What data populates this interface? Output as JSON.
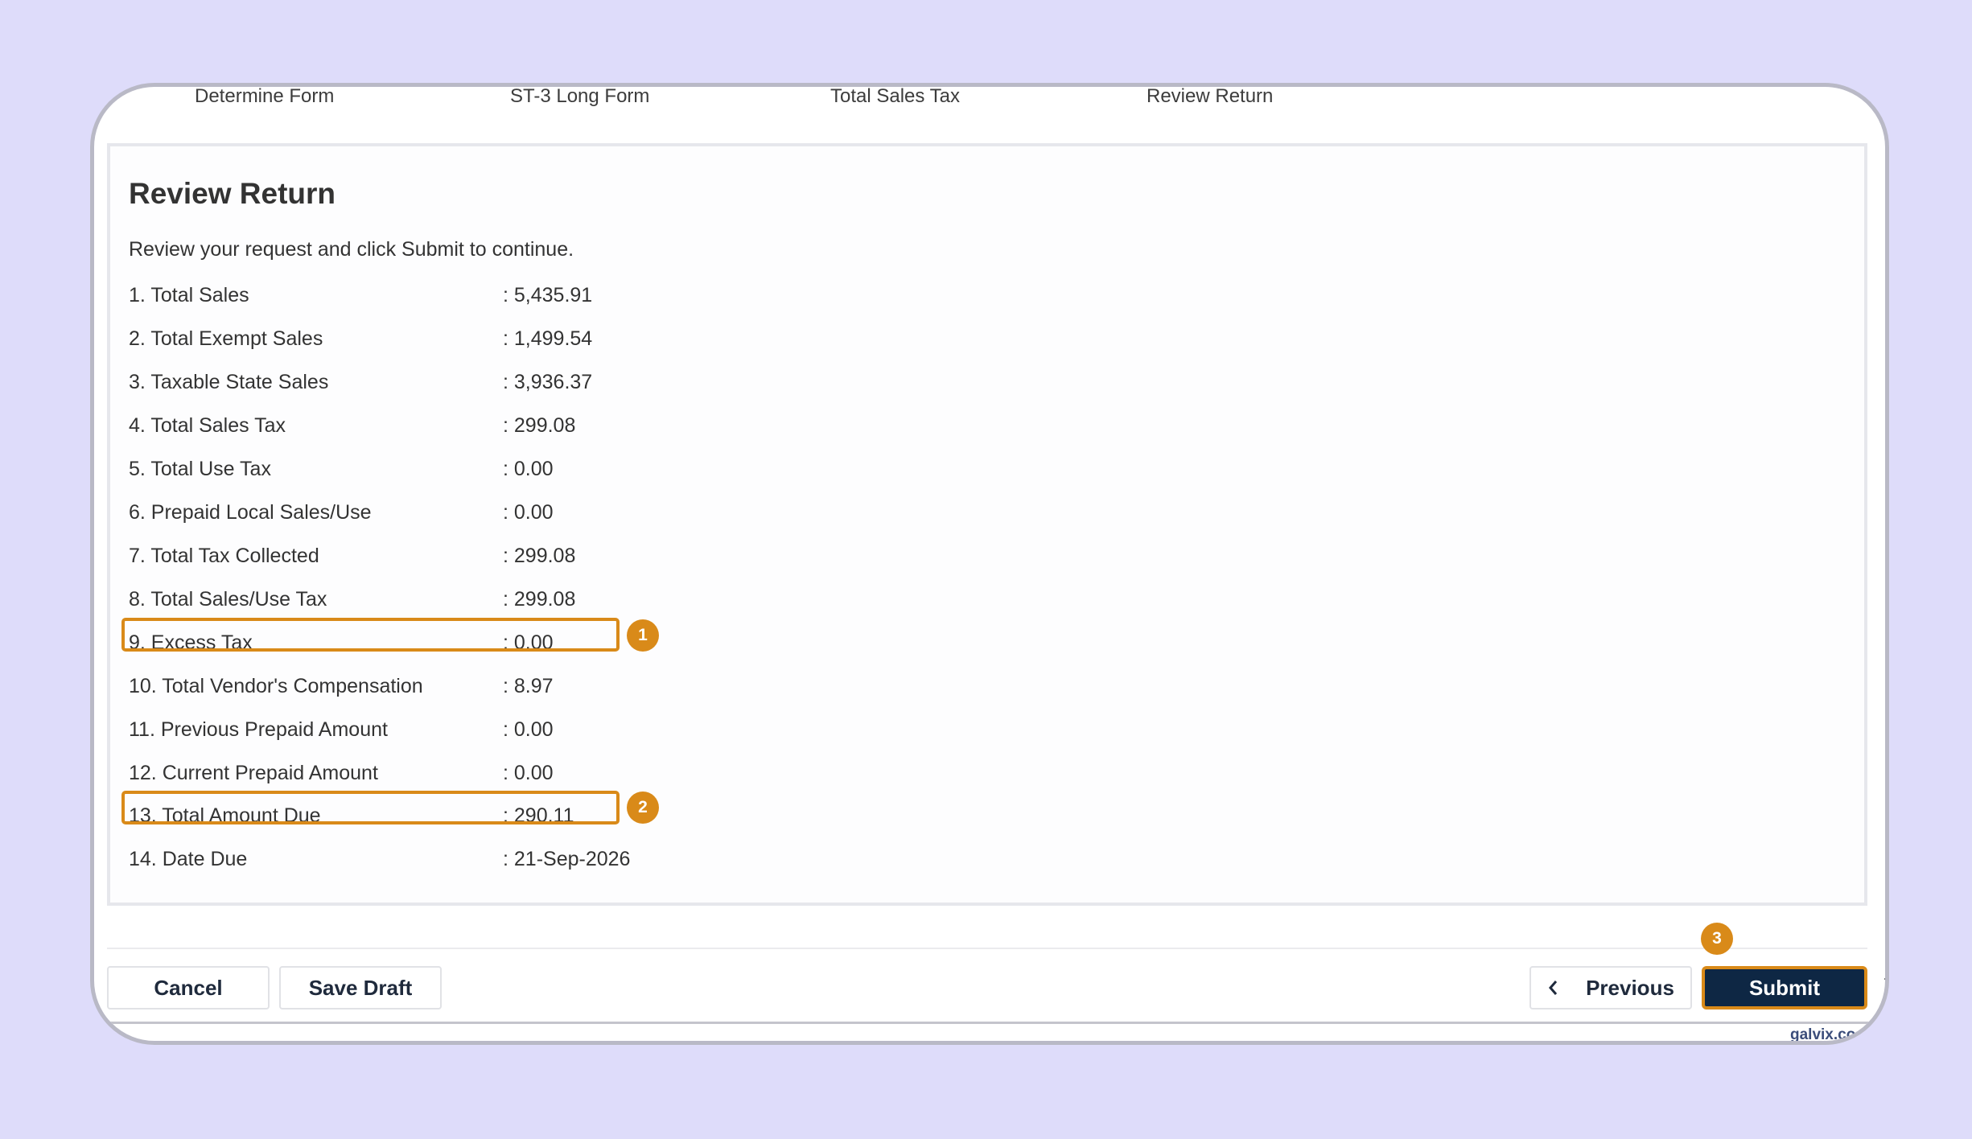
{
  "steps": [
    "Determine Form",
    "ST-3 Long Form",
    "Total Sales Tax",
    "Review Return"
  ],
  "review": {
    "title": "Review Return",
    "description": "Review your request and click Submit to continue.",
    "rows": [
      {
        "label": "1. Total Sales",
        "value": ": 5,435.91"
      },
      {
        "label": "2. Total Exempt Sales",
        "value": ": 1,499.54"
      },
      {
        "label": "3. Taxable State Sales",
        "value": ": 3,936.37"
      },
      {
        "label": "4. Total Sales Tax",
        "value": ": 299.08"
      },
      {
        "label": "5. Total Use Tax",
        "value": ": 0.00"
      },
      {
        "label": "6. Prepaid Local Sales/Use",
        "value": ": 0.00"
      },
      {
        "label": "7. Total Tax Collected",
        "value": ": 299.08"
      },
      {
        "label": "8. Total Sales/Use Tax",
        "value": ": 299.08"
      },
      {
        "label": "9. Excess Tax",
        "value": ": 0.00"
      },
      {
        "label": "10. Total Vendor's Compensation",
        "value": ": 8.97"
      },
      {
        "label": "11. Previous Prepaid Amount",
        "value": ": 0.00"
      },
      {
        "label": "12. Current Prepaid Amount",
        "value": ": 0.00"
      },
      {
        "label": "13. Total Amount Due",
        "value": ": 290.11"
      },
      {
        "label": "14. Date Due",
        "value": ": 21-Sep-2026"
      }
    ]
  },
  "annotations": {
    "badge1": "1",
    "badge2": "2",
    "badge3": "3",
    "accent_color": "#d98a19"
  },
  "footer": {
    "cancel_label": "Cancel",
    "save_draft_label": "Save Draft",
    "previous_label": "Previous",
    "submit_label": "Submit"
  },
  "watermark": "galvix.co",
  "colors": {
    "background": "#dedcfa",
    "submit_bg": "#0e2744"
  }
}
